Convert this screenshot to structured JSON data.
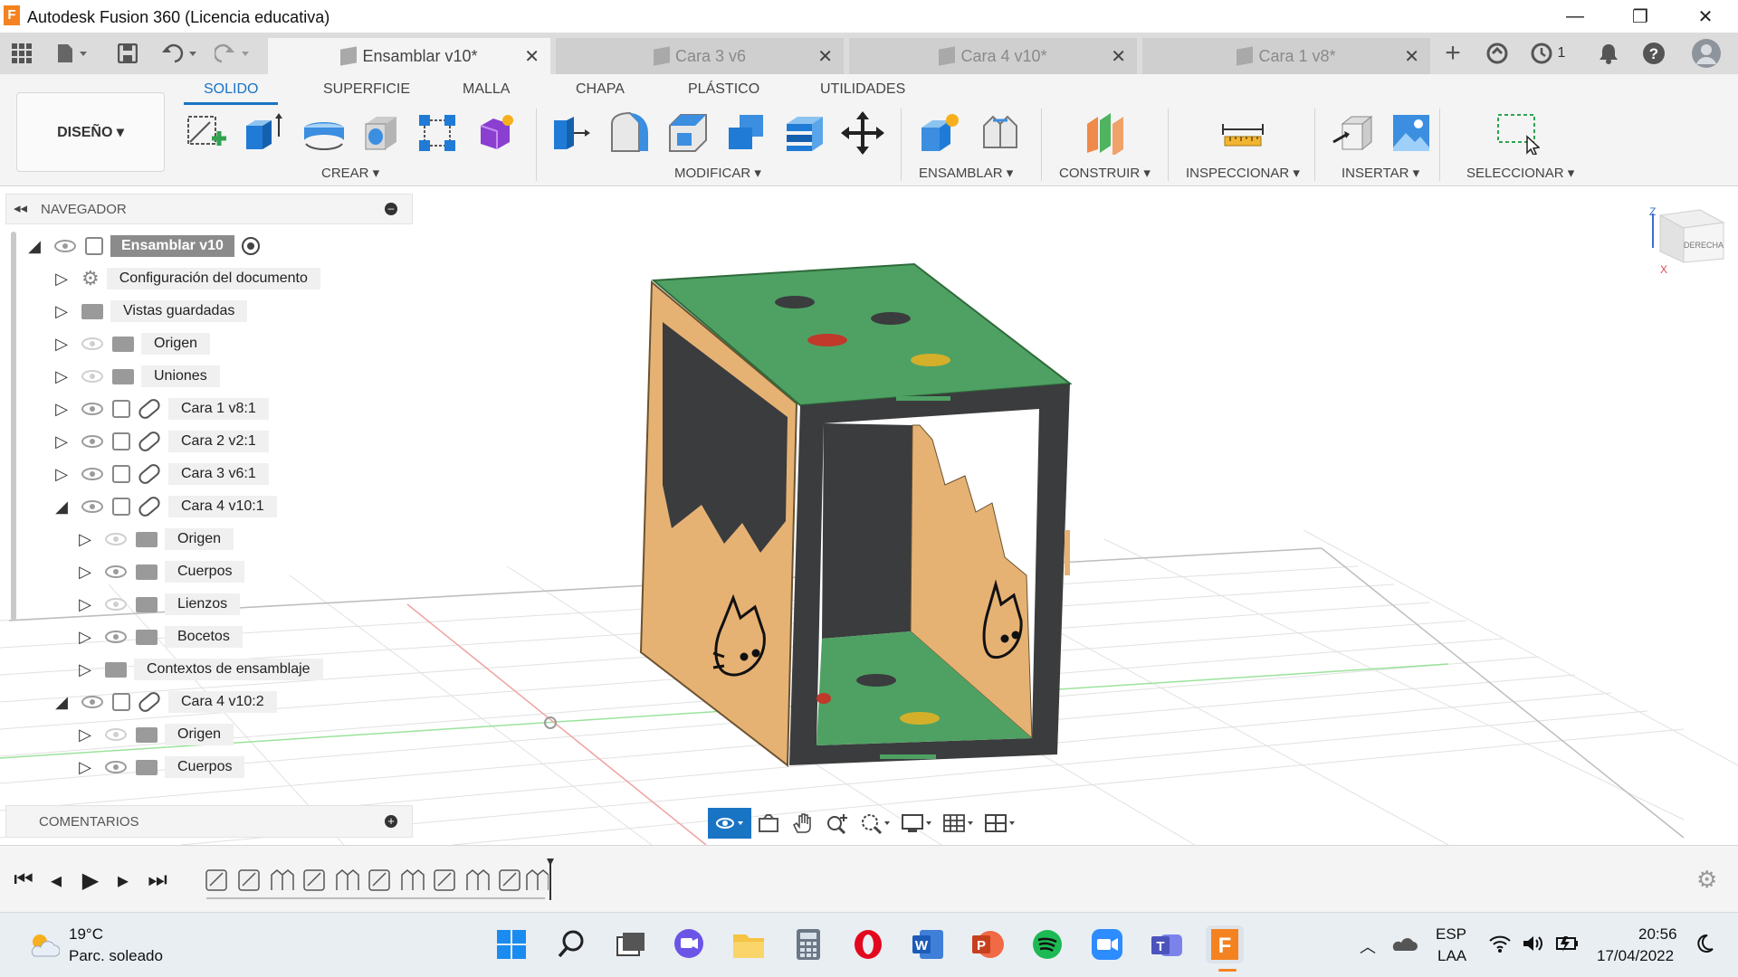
{
  "window": {
    "title": "Autodesk Fusion 360 (Licencia educativa)",
    "logo_letter": "F",
    "minimize": "—",
    "restore": "❐",
    "close": "✕"
  },
  "tabs": [
    {
      "label": "Ensamblar v10*",
      "active": true
    },
    {
      "label": "Cara 3 v6",
      "active": false
    },
    {
      "label": "Cara 4 v10*",
      "active": false
    },
    {
      "label": "Cara 1 v8*",
      "active": false
    }
  ],
  "tabbar": {
    "jobs_count": "1",
    "new_tab": "+"
  },
  "menu_tabs": [
    "SOLIDO",
    "SUPERFICIE",
    "MALLA",
    "CHAPA",
    "PLÁSTICO",
    "UTILIDADES"
  ],
  "design_button": "DISEÑO ▾",
  "tool_groups": [
    "CREAR ▾",
    "MODIFICAR ▾",
    "ENSAMBLAR ▾",
    "CONSTRUIR ▾",
    "INSPECCIONAR ▾",
    "INSERTAR ▾",
    "SELECCIONAR ▾"
  ],
  "navigator": {
    "title": "NAVEGADOR",
    "rows": [
      {
        "label": "Ensamblar v10",
        "kind": "root"
      },
      {
        "label": "Configuración del documento",
        "kind": "gear"
      },
      {
        "label": "Vistas guardadas",
        "kind": "folder"
      },
      {
        "label": "Origen",
        "kind": "folder-hidden"
      },
      {
        "label": "Uniones",
        "kind": "folder-hidden"
      },
      {
        "label": "Cara 1 v8:1",
        "kind": "component"
      },
      {
        "label": "Cara 2 v2:1",
        "kind": "component"
      },
      {
        "label": "Cara 3 v6:1",
        "kind": "component"
      },
      {
        "label": "Cara 4 v10:1",
        "kind": "component-open"
      },
      {
        "label": "Origen",
        "kind": "sub-hidden"
      },
      {
        "label": "Cuerpos",
        "kind": "sub"
      },
      {
        "label": "Lienzos",
        "kind": "sub-hidden"
      },
      {
        "label": "Bocetos",
        "kind": "sub"
      },
      {
        "label": "Contextos de ensamblaje",
        "kind": "sub-folder"
      },
      {
        "label": "Cara 4 v10:2",
        "kind": "component-open"
      },
      {
        "label": "Origen",
        "kind": "sub-hidden"
      },
      {
        "label": "Cuerpos",
        "kind": "sub"
      }
    ]
  },
  "comments": {
    "title": "COMENTARIOS"
  },
  "viewcube": {
    "face": "DERECHA",
    "axis_z": "Z",
    "axis_x": "X"
  },
  "taskbar": {
    "weather_temp": "19°C",
    "weather_desc": "Parc. soleado",
    "lang_top": "ESP",
    "lang_bottom": "LAA",
    "time": "20:56",
    "date": "17/04/2022"
  },
  "colors": {
    "accent": "#1a74c4",
    "green_panel": "#4fa163",
    "wood": "#e6b274",
    "dark_panel": "#3a3c3e",
    "fusion_orange": "#f58220"
  }
}
